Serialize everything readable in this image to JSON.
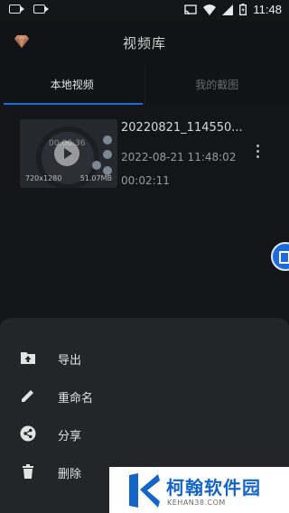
{
  "status_bar": {
    "time": "11:48",
    "icons": [
      "video-camera-icon",
      "video-camera-icon",
      "cast-icon",
      "wifi-icon",
      "signal-icon",
      "battery-icon"
    ]
  },
  "header": {
    "title": "视频库",
    "left_icon": "gem-icon"
  },
  "tabs": [
    {
      "label": "本地视频",
      "active": true
    },
    {
      "label": "我的截图",
      "active": false
    }
  ],
  "videos": [
    {
      "name": "20220821_114550...",
      "date": "2022-08-21 11:48:02",
      "duration": "00:02:11",
      "resolution": "720x1280",
      "size": "51.07MB",
      "thumb_time": "00:00:36"
    }
  ],
  "menu": [
    {
      "label": "导出",
      "icon": "folder-upload-icon"
    },
    {
      "label": "重命名",
      "icon": "pencil-icon"
    },
    {
      "label": "分享",
      "icon": "share-icon"
    },
    {
      "label": "删除",
      "icon": "trash-icon"
    }
  ],
  "watermark": {
    "title": "柯翰软件园",
    "subtitle": "KEHAN38.COM"
  },
  "colors": {
    "accent": "#1d6bd9",
    "background": "#0f1012",
    "sheet": "#242528",
    "watermark_blue": "#1565c8"
  }
}
